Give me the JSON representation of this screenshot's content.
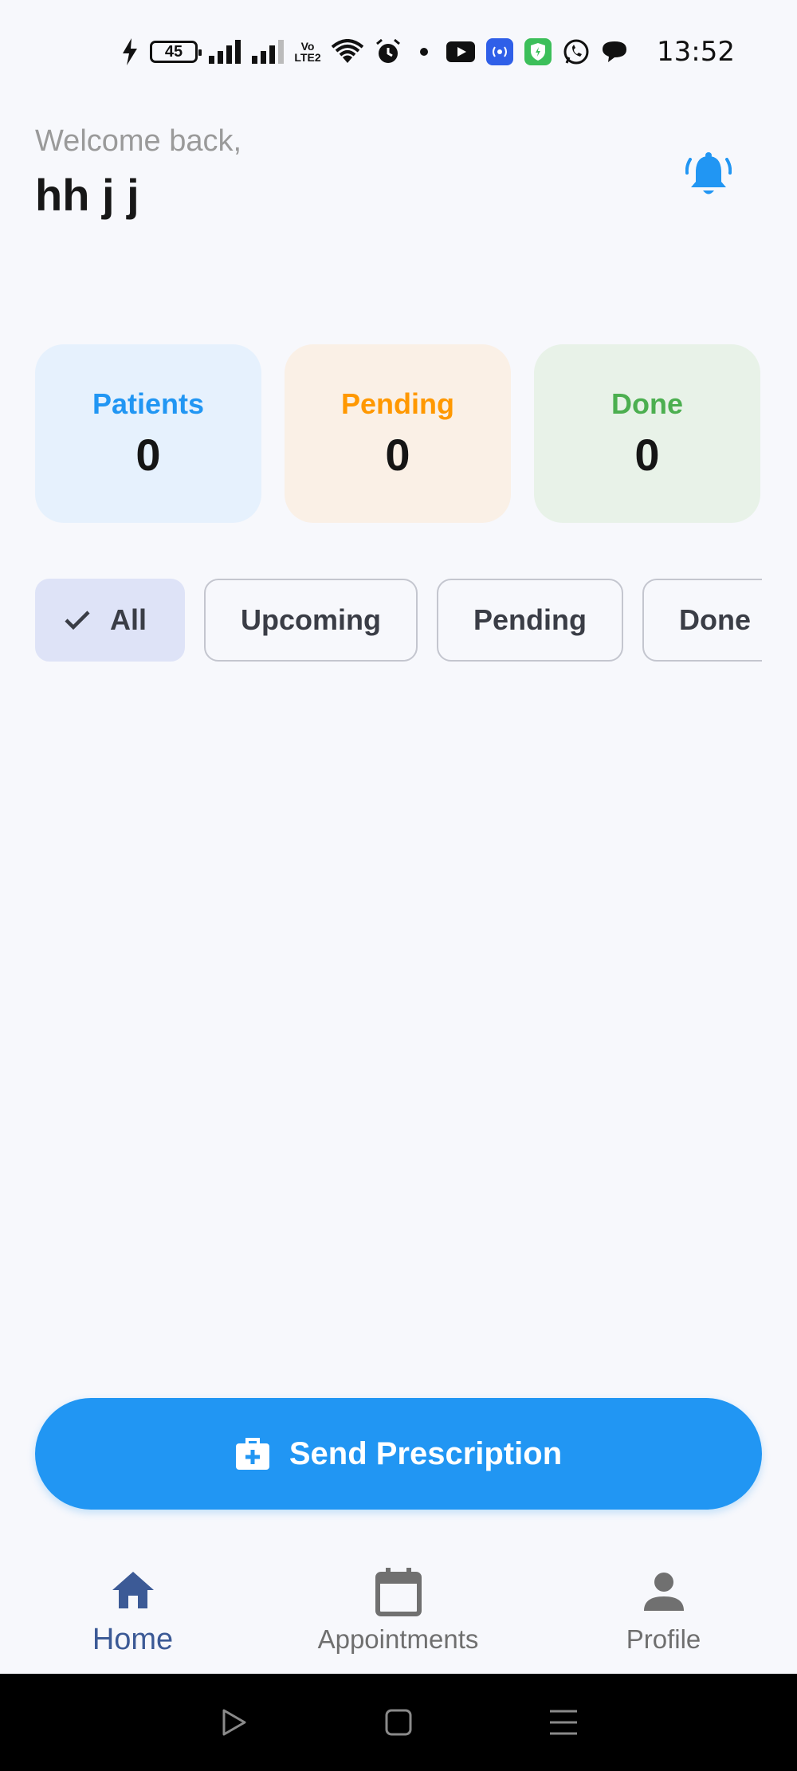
{
  "status_bar": {
    "battery_level": "45",
    "volte_label": "Vo LTE2",
    "time": "13:52"
  },
  "header": {
    "welcome_text": "Welcome back,",
    "user_name": "hh j j"
  },
  "stats": [
    {
      "label": "Patients",
      "value": "0",
      "color": "#2196F3",
      "bg": "#E6F1FD"
    },
    {
      "label": "Pending",
      "value": "0",
      "color": "#FF9800",
      "bg": "#FAF0E6"
    },
    {
      "label": "Done",
      "value": "0",
      "color": "#4CAF50",
      "bg": "#E8F2E8"
    }
  ],
  "filters": {
    "selected": "All",
    "chips": [
      {
        "label": "All"
      },
      {
        "label": "Upcoming"
      },
      {
        "label": "Pending"
      },
      {
        "label": "Done"
      }
    ]
  },
  "actions": {
    "send_prescription_label": "Send Prescription",
    "accent_color": "#2196F3"
  },
  "bottom_nav": {
    "active": "Home",
    "items": [
      {
        "label": "Home",
        "icon": "home-icon"
      },
      {
        "label": "Appointments",
        "icon": "calendar-icon"
      },
      {
        "label": "Profile",
        "icon": "person-icon"
      }
    ]
  }
}
